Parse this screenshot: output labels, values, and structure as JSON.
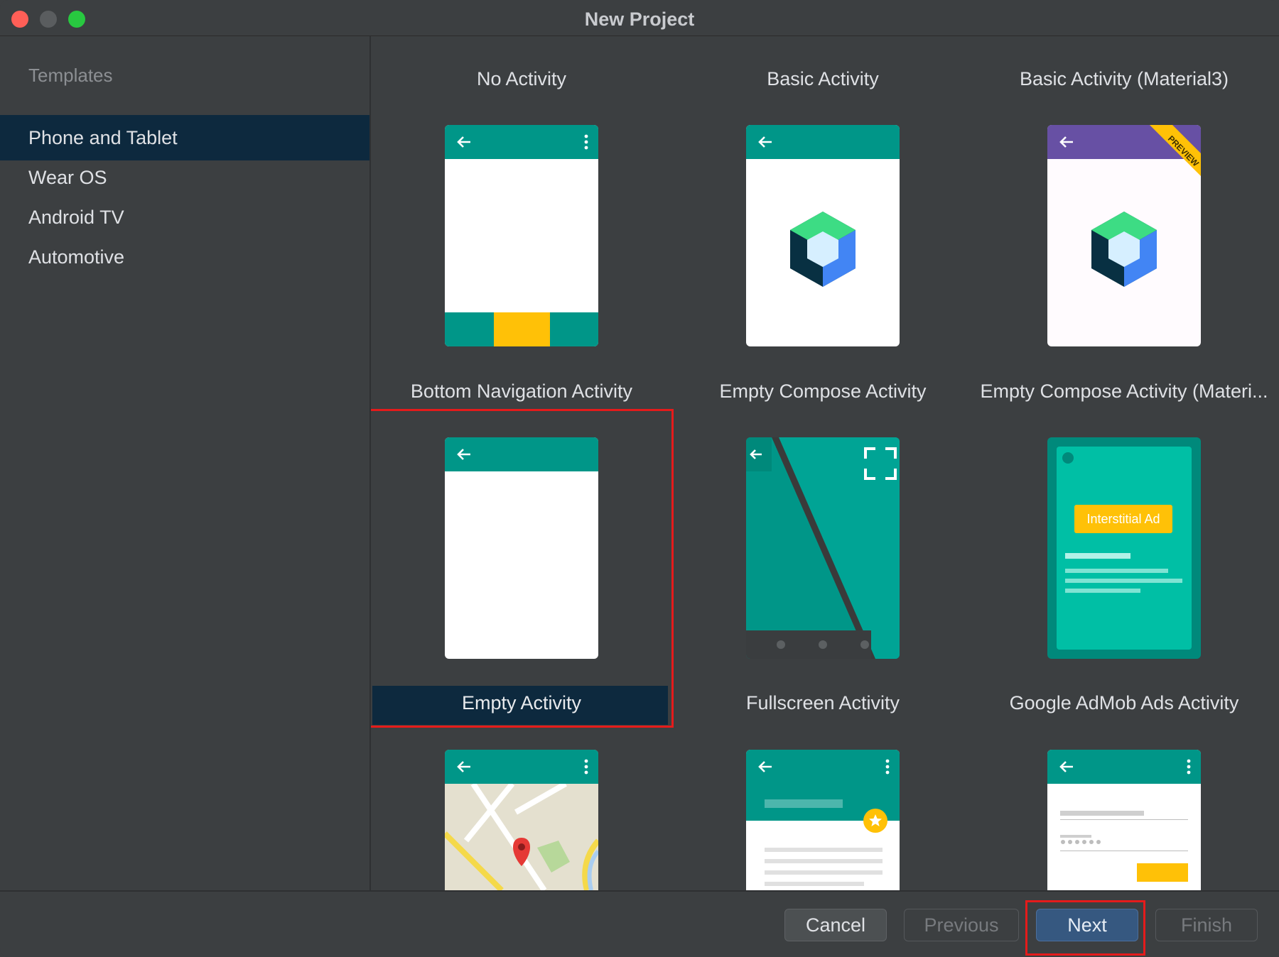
{
  "window": {
    "title": "New Project"
  },
  "sidebar": {
    "header": "Templates",
    "items": [
      {
        "label": "Phone and Tablet",
        "selected": true
      },
      {
        "label": "Wear OS",
        "selected": false
      },
      {
        "label": "Android TV",
        "selected": false
      },
      {
        "label": "Automotive",
        "selected": false
      }
    ]
  },
  "templates": [
    {
      "label": "No Activity"
    },
    {
      "label": "Basic Activity"
    },
    {
      "label": "Basic Activity (Material3)",
      "badge": "PREVIEW"
    },
    {
      "label": "Bottom Navigation Activity"
    },
    {
      "label": "Empty Compose Activity"
    },
    {
      "label": "Empty Compose Activity (Materi..."
    },
    {
      "label": "Empty Activity",
      "selected": true
    },
    {
      "label": "Fullscreen Activity"
    },
    {
      "label": "Google AdMob Ads Activity",
      "ad_label": "Interstitial Ad"
    }
  ],
  "footer": {
    "cancel": "Cancel",
    "previous": "Previous",
    "next": "Next",
    "finish": "Finish"
  },
  "colors": {
    "teal": "#009688",
    "purple": "#6750a4",
    "amber": "#ffc107",
    "selection": "#0d293e",
    "highlight_red": "#e51b1b"
  }
}
